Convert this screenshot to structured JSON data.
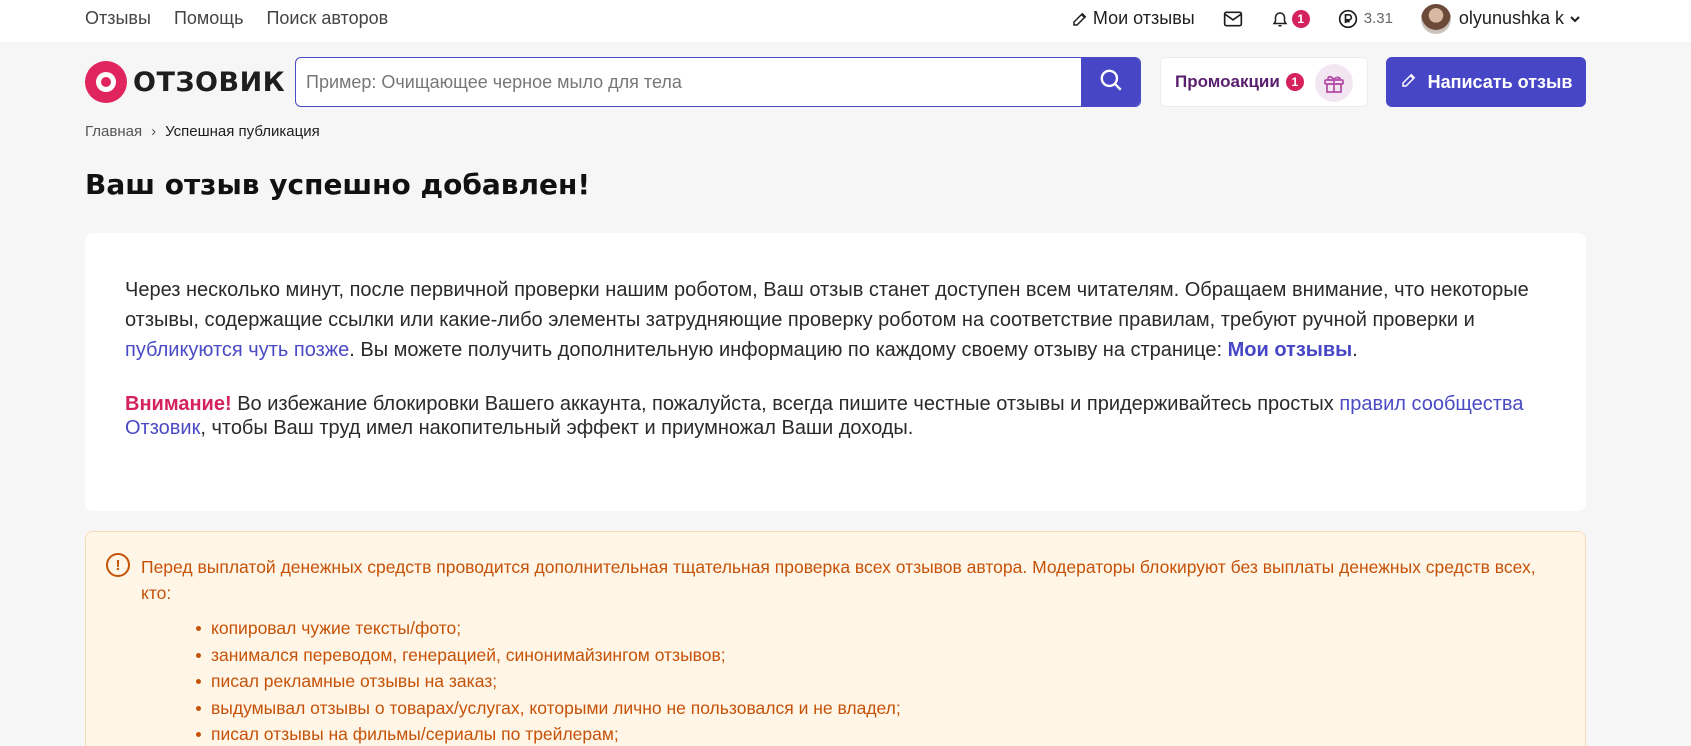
{
  "topnav": {
    "items": [
      "Отзывы",
      "Помощь",
      "Поиск авторов"
    ]
  },
  "user_bar": {
    "my_reviews_label": "Мои отзывы",
    "notifications_count": "1",
    "balance": "3.31",
    "username": "olyunushka k"
  },
  "header": {
    "logo_text": "ОТЗОВИК",
    "search_placeholder": "Пример: Очищающее черное мыло для тела",
    "promo_label": "Промоакции",
    "promo_count": "1",
    "write_button": "Написать отзыв"
  },
  "breadcrumb": {
    "home": "Главная",
    "separator": "›",
    "current": "Успешная публикация"
  },
  "page_title": "Ваш отзыв успешно добавлен!",
  "card": {
    "p1_text1": "Через несколько минут, после первичной проверки нашим роботом, Ваш отзыв станет доступен всем читателям. Обращаем внимание, что некоторые отзывы, содержащие ссылки или какие-либо элементы затрудняющие проверку роботом на соответствие правилам, требуют ручной проверки и ",
    "p1_link": "публикуются чуть позже",
    "p1_text2": ". Вы можете получить дополнительную информацию по каждому своему отзыву на странице: ",
    "p1_link2": "Мои отзывы",
    "p1_end": ".",
    "warning_title": "Внимание!",
    "p2_text1": " Во избежание блокировки Вашего аккаунта, пожалуйста, всегда пишите честные отзывы и придерживайтесь простых ",
    "p2_link": "правил сообщества Отзовик",
    "p2_text2": ", чтобы Ваш труд имел накопительный эффект и приумножал Ваши доходы."
  },
  "warning": {
    "icon": "exclamation-circle-icon",
    "text": "Перед выплатой денежных средств проводится дополнительная тщательная проверка всех отзывов автора. Модераторы блокируют без выплаты денежных средств всех, кто:",
    "items": [
      "копировал чужие тексты/фото;",
      "занимался переводом, генерацией, синонимайзингом отзывов;",
      "писал рекламные отзывы на заказ;",
      "выдумывал отзывы о товарах/услугах, которыми лично не пользовался и не владел;",
      "писал отзывы на фильмы/сериалы по трейлерам;"
    ]
  },
  "colors": {
    "accent": "#4646c6",
    "brand": "#e0245e",
    "warning_text": "#c65208",
    "warning_bg": "#fff6e8"
  }
}
